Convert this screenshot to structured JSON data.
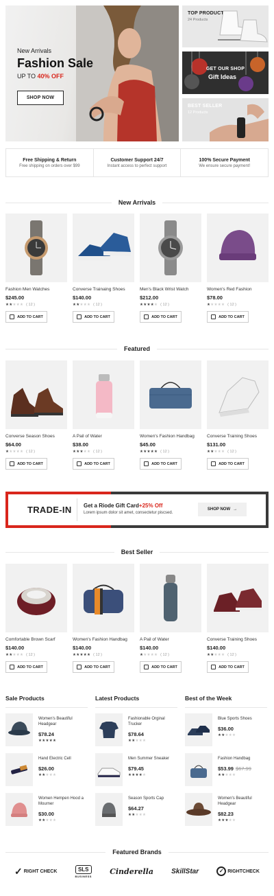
{
  "hero": {
    "subtitle": "New Arrivals",
    "title": "Fashion Sale",
    "offer_prefix": "UP TO",
    "offer_value": "40% OFF",
    "cta": "SHOP NOW"
  },
  "promos": [
    {
      "title": "TOP PRODUCTS",
      "sub": "24 Products"
    },
    {
      "title": "GET OUR SHOP",
      "sub": "Gift Ideas"
    },
    {
      "title": "BEST SELLER",
      "sub": "12 Products"
    }
  ],
  "features": [
    {
      "title": "Free Shipping & Return",
      "sub": "Free shipping on orders over $99"
    },
    {
      "title": "Customer Support 24/7",
      "sub": "Instant access to perfect support"
    },
    {
      "title": "100% Secure Payment",
      "sub": "We ensure secure payment!"
    }
  ],
  "sections": {
    "new_arrivals": "New Arrivals",
    "featured": "Featured",
    "best_seller": "Best Seller",
    "brands": "Featured Brands"
  },
  "add_to_cart": "ADD TO CART",
  "new_arrivals": [
    {
      "name": "Fashion Men Watches",
      "price": "$245.00",
      "stars": 2,
      "reviews": "( 12 )"
    },
    {
      "name": "Converse Trainaing Shoes",
      "price": "$140.00",
      "stars": 2,
      "reviews": "( 12 )"
    },
    {
      "name": "Men's Black Wrist Watch",
      "price": "$212.00",
      "stars": 4,
      "reviews": "( 12 )"
    },
    {
      "name": "Women's Red Fashion",
      "price": "$78.00",
      "stars": 1,
      "reviews": "( 12 )"
    }
  ],
  "featured": [
    {
      "name": "Converse Season Shoes",
      "price": "$64.00",
      "stars": 1,
      "reviews": "( 12 )"
    },
    {
      "name": "A Pail of Water",
      "price": "$38.00",
      "stars": 3,
      "reviews": "( 12 )"
    },
    {
      "name": "Women's Fashion Handbag",
      "price": "$45.00",
      "stars": 5,
      "reviews": "( 12 )"
    },
    {
      "name": "Converse Training Shoes",
      "price": "$131.00",
      "stars": 2,
      "reviews": "( 12 )"
    }
  ],
  "best_seller": [
    {
      "name": "Comfortable Brown Scarf",
      "price": "$140.00",
      "stars": 2,
      "reviews": "( 12 )"
    },
    {
      "name": "Women's Fashion Handbag",
      "price": "$140.00",
      "stars": 5,
      "reviews": "( 12 )"
    },
    {
      "name": "A Pail of Water",
      "price": "$140.00",
      "stars": 1,
      "reviews": "( 12 )"
    },
    {
      "name": "Converse Training Shoes",
      "price": "$140.00",
      "stars": 2,
      "reviews": "( 12 )"
    }
  ],
  "trade": {
    "title": "TRADE-IN",
    "headline": "Get a Riode Gift Card",
    "headline_accent": "+25% Off",
    "sub": "Lorem ipsum dolor sit amet, consectetur piscsed.",
    "cta": "SHOP NOW"
  },
  "lists": [
    {
      "title": "Sale Products",
      "items": [
        {
          "name": "Women's Beautiful Headgear",
          "price": "$78.24",
          "old": "",
          "stars": 5
        },
        {
          "name": "Hand Electric Cell",
          "price": "$26.00",
          "old": "",
          "stars": 2
        },
        {
          "name": "Women Hempen Hood a Mourner",
          "price": "$30.00",
          "old": "",
          "stars": 2
        }
      ]
    },
    {
      "title": "Latest Products",
      "items": [
        {
          "name": "Fashionable Orginal Trucker",
          "price": "$78.64",
          "old": "",
          "stars": 2
        },
        {
          "name": "Men Summer Sneaker",
          "price": "$79.45",
          "old": "",
          "stars": 4
        },
        {
          "name": "Season Sports Cap",
          "price": "$64.27",
          "old": "",
          "stars": 2
        }
      ]
    },
    {
      "title": "Best of the Week",
      "items": [
        {
          "name": "Blue Sports Shoes",
          "price": "$36.00",
          "old": "",
          "stars": 2
        },
        {
          "name": "Fashion Handbag",
          "price": "$53.99",
          "old": "$67.99",
          "stars": 2
        },
        {
          "name": "Women's Beautiful Headgear",
          "price": "$82.23",
          "old": "",
          "stars": 3
        }
      ]
    }
  ],
  "brand_names": [
    "RIGHT CHECK",
    "SLS",
    "Cinderella",
    "SkillStar",
    "RIGHTCHECK"
  ],
  "brand_sub": [
    "",
    "BUSINESS",
    "",
    "",
    ""
  ],
  "colors": {
    "accent": "#d9261c",
    "dark": "#222222"
  }
}
